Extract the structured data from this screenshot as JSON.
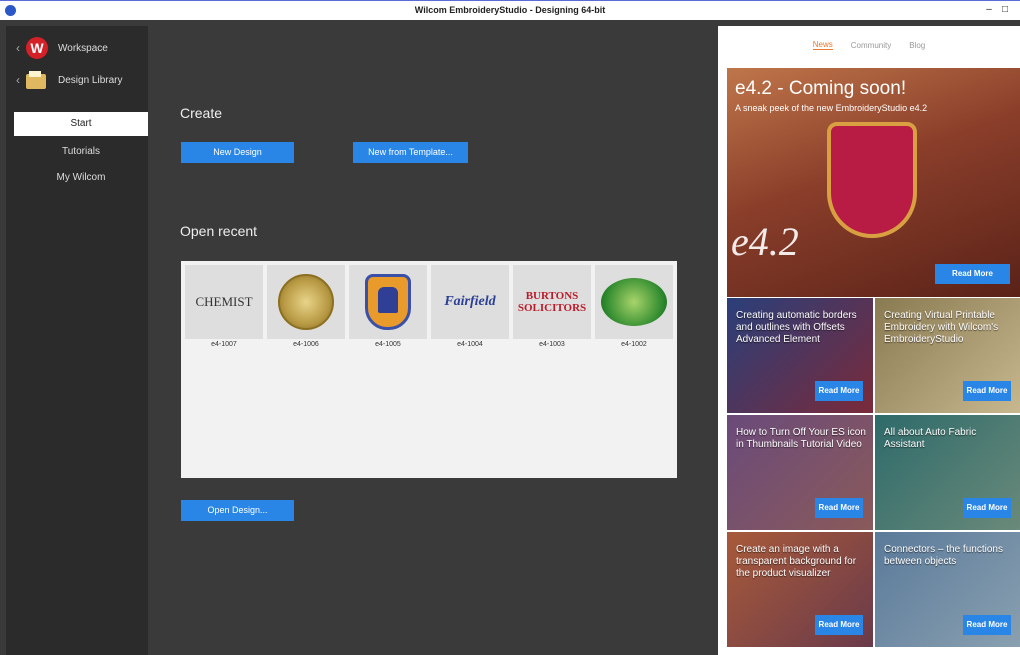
{
  "window": {
    "title": "Wilcom EmbroideryStudio - Designing 64-bit"
  },
  "nav": {
    "workspace_label": "Workspace",
    "design_library_label": "Design Library",
    "items": [
      {
        "label": "Start",
        "active": true
      },
      {
        "label": "Tutorials",
        "active": false
      },
      {
        "label": "My Wilcom",
        "active": false
      }
    ]
  },
  "main": {
    "create_heading": "Create",
    "new_design_label": "New Design",
    "new_from_template_label": "New from Template...",
    "open_recent_heading": "Open recent",
    "recent": [
      {
        "label": "e4-1007",
        "art": "CHEMIST"
      },
      {
        "label": "e4-1006",
        "art": ""
      },
      {
        "label": "e4-1005",
        "art": ""
      },
      {
        "label": "e4-1004",
        "art": "Fairfield"
      },
      {
        "label": "e4-1003",
        "art": "BURTONS SOLICITORS"
      },
      {
        "label": "e4-1002",
        "art": ""
      }
    ],
    "open_design_label": "Open Design..."
  },
  "right": {
    "tabs": [
      {
        "label": "News",
        "active": true
      },
      {
        "label": "Community",
        "active": false
      },
      {
        "label": "Blog",
        "active": false
      }
    ],
    "hero": {
      "title": "e4.2 - Coming soon!",
      "subtitle": "A sneak peek of the new EmbroideryStudio e4.2",
      "big_text": "e4.2",
      "read_more": "Read More"
    },
    "cards": [
      {
        "title": "Creating automatic borders and outlines with Offsets Advanced Element",
        "read_more": "Read More",
        "color": "#2a3f7a"
      },
      {
        "title": "Creating Virtual Printable Embroidery with Wilcom's EmbroideryStudio",
        "read_more": "Read More",
        "color": "#8a7a52"
      },
      {
        "title": "How to Turn Off Your ES icon in Thumbnails Tutorial Video",
        "read_more": "Read More",
        "color": "#6a4a7a"
      },
      {
        "title": "All about Auto Fabric Assistant",
        "read_more": "Read More",
        "color": "#2e6a6a"
      },
      {
        "title": "Create an image with a transparent background for the product visualizer",
        "read_more": "Read More",
        "color": "#a85a3a"
      },
      {
        "title": "Connectors – the functions between objects",
        "read_more": "Read More",
        "color": "#5a7a9a"
      }
    ]
  }
}
